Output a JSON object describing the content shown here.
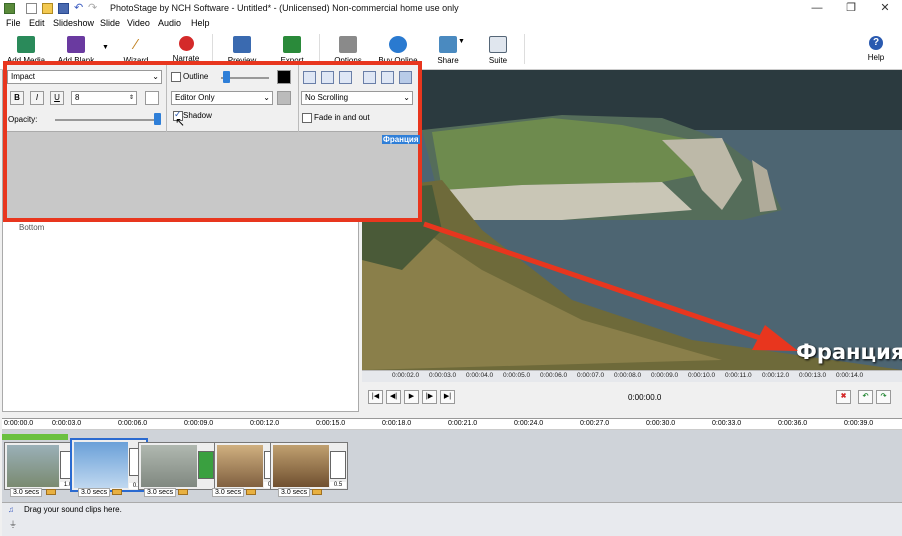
{
  "window": {
    "title": "PhotoStage by NCH Software - Untitled* - (Unlicensed) Non-commercial home use only",
    "controls": [
      "—",
      "❐",
      "✕"
    ]
  },
  "menu": [
    "File",
    "Edit",
    "Slideshow",
    "Slide",
    "Video",
    "Audio",
    "Help"
  ],
  "toolbar": {
    "add_media": "Add Media",
    "add_blank": "Add Blank",
    "wizard": "Wizard",
    "narrate": "Narrate",
    "preview": "Preview",
    "export": "Export",
    "options": "Options",
    "buy_online": "Buy Online",
    "share": "Share",
    "suite": "Suite",
    "help": "Help"
  },
  "text_panel": {
    "font": "Impact",
    "bold": "B",
    "italic": "I",
    "underline": "U",
    "size": "8",
    "opacity_label": "Opacity:",
    "outline_label": "Outline",
    "visibility": "Editor Only",
    "shadow_label": "Shadow",
    "scrolling": "No Scrolling",
    "fade_label": "Fade in and out",
    "preview_text": "Франция"
  },
  "left_pane": {
    "item": "Bottom"
  },
  "overlay_text": "Франция",
  "preview_ruler": [
    "0:00:02.0",
    "0:00:03.0",
    "0:00:04.0",
    "0:00:05.0",
    "0:00:06.0",
    "0:00:07.0",
    "0:00:08.0",
    "0:00:09.0",
    "0:00:10.0",
    "0:00:11.0",
    "0:00:12.0",
    "0:00:13.0",
    "0:00:14.0"
  ],
  "timecode": "0:00:00.0",
  "timeline_ticks": [
    "0:00:00.0",
    "0:00:03.0",
    "0:00:06.0",
    "0:00:09.0",
    "0:00:12.0",
    "0:00:15.0",
    "0:00:18.0",
    "0:00:21.0",
    "0:00:24.0",
    "0:00:27.0",
    "0:00:30.0",
    "0:00:33.0",
    "0:00:36.0",
    "0:00:39.0"
  ],
  "clips": [
    {
      "duration": "3.0 secs",
      "transition": "1.0"
    },
    {
      "duration": "3.0 secs",
      "transition": "0.5"
    },
    {
      "duration": "3.0 secs",
      "transition": ""
    },
    {
      "duration": "3.0 secs",
      "transition": "0.5"
    },
    {
      "duration": "3.0 secs",
      "transition": "0.5"
    }
  ],
  "sound_track": "Drag your sound clips here.",
  "colors": {
    "highlight": "#e8361e",
    "accent": "#2f7fd8"
  }
}
